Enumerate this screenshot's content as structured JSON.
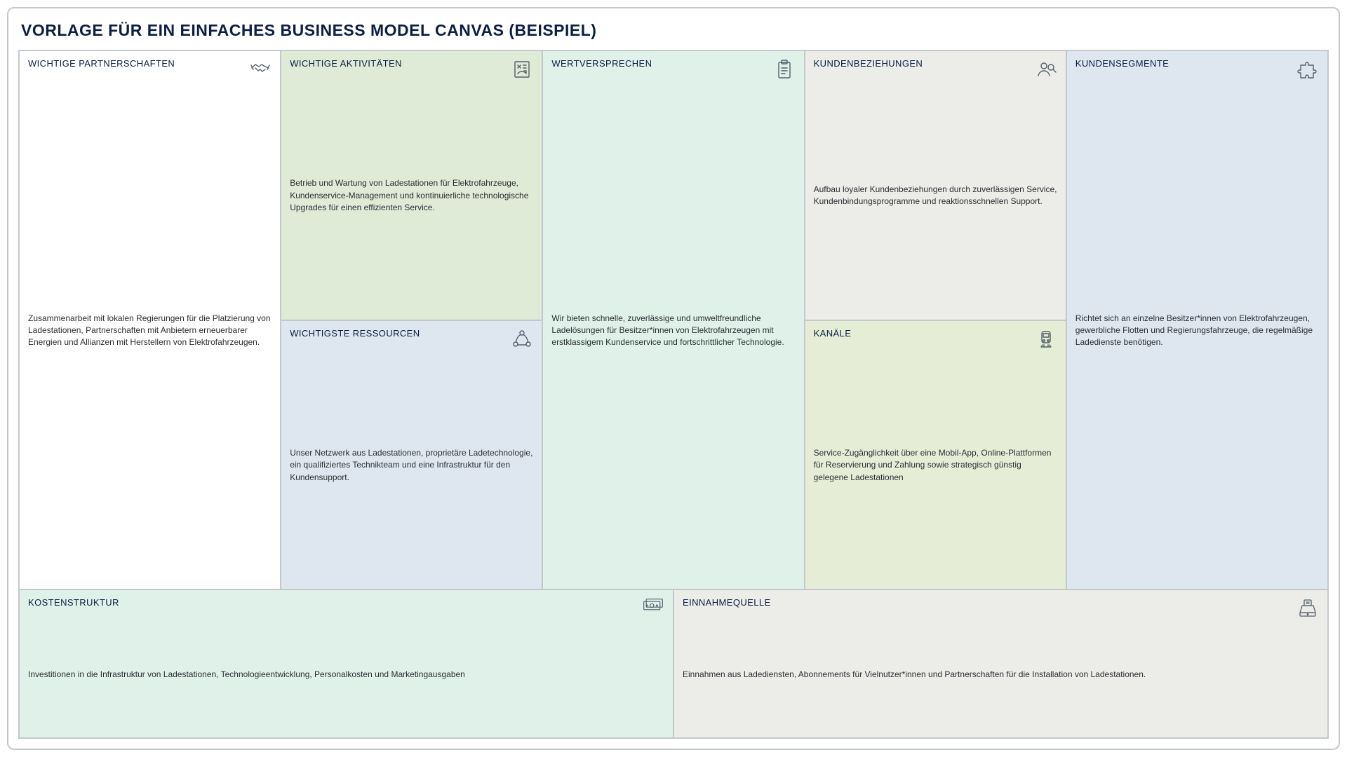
{
  "title": "VORLAGE FÜR EIN EINFACHES BUSINESS MODEL CANVAS (BEISPIEL)",
  "blocks": {
    "kp": {
      "title": "WICHTIGE PARTNERSCHAFTEN",
      "text": "Zusammenarbeit mit lokalen Regierungen für die Platzierung von Ladestationen, Partnerschaften mit Anbietern erneuerbarer Energien und Allianzen mit Herstellern von Elektrofahrzeugen."
    },
    "ka": {
      "title": "WICHTIGE AKTIVITÄTEN",
      "text": "Betrieb und Wartung von Ladestationen für Elektrofahrzeuge, Kundenservice-Management und kontinuierliche technologische Upgrades für einen effizienten Service."
    },
    "kr": {
      "title": "WICHTIGSTE RESSOURCEN",
      "text": "Unser Netzwerk aus Ladestationen, proprietäre Ladetechnologie, ein qualifiziertes Technikteam und eine Infrastruktur für den Kundensupport."
    },
    "vp": {
      "title": "WERTVERSPRECHEN",
      "text": "Wir bieten schnelle, zuverlässige und umweltfreundliche Ladelösungen für Besitzer*innen von Elektrofahrzeugen mit erstklassigem Kundenservice und fortschrittlicher Technologie."
    },
    "cr": {
      "title": "KUNDENBEZIEHUNGEN",
      "text": "Aufbau loyaler Kundenbeziehungen durch zuverlässigen Service, Kundenbindungsprogramme und reaktionsschnellen Support."
    },
    "ch": {
      "title": "KANÄLE",
      "text": "Service-Zugänglichkeit über eine Mobil-App, Online-Plattformen für Reservierung und Zahlung sowie strategisch günstig gelegene Ladestationen"
    },
    "cs": {
      "title": "KUNDENSEGMENTE",
      "text": "Richtet sich an einzelne Besitzer*innen von Elektrofahrzeugen, gewerbliche Flotten und Regierungsfahrzeuge, die regelmäßige Ladedienste benötigen."
    },
    "co": {
      "title": "KOSTENSTRUKTUR",
      "text": "Investitionen in die Infrastruktur von Ladestationen, Technologieentwicklung, Personalkosten und Marketingausgaben"
    },
    "rs": {
      "title": "EINNAHMEQUELLE",
      "text": "Einnahmen aus Ladediensten, Abonnements für Vielnutzer*innen und Partnerschaften für die Installation von Ladestationen."
    }
  },
  "colors": {
    "kp": "c-white",
    "ka": "c-green",
    "kr": "c-blue",
    "vp": "c-mint",
    "cr": "c-gray",
    "ch": "c-olive",
    "cs": "c-blue",
    "co": "c-mint",
    "rs": "c-gray"
  }
}
